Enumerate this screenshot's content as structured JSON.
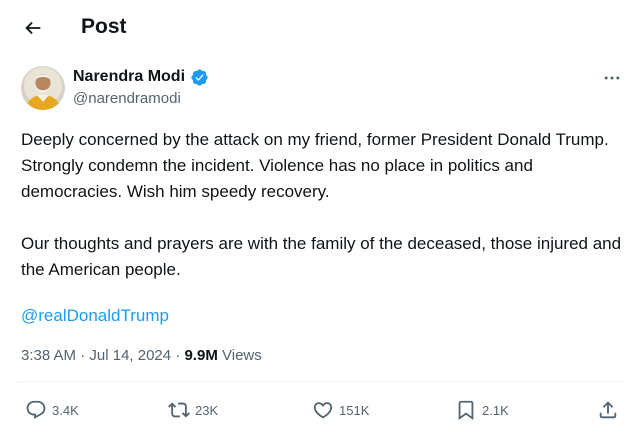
{
  "header": {
    "title": "Post"
  },
  "author": {
    "name": "Narendra Modi",
    "handle": "@narendramodi",
    "verified": true
  },
  "post": {
    "paragraph1": "Deeply concerned by the attack on my friend, former President Donald Trump. Strongly condemn the incident. Violence has no place in politics and democracies. Wish him speedy recovery.",
    "paragraph2": "Our thoughts and prayers are with the family of the deceased, those injured and the American people.",
    "mention": "@realDonaldTrump"
  },
  "meta": {
    "time": "3:38 AM",
    "separator": "·",
    "date": "Jul 14, 2024",
    "views_count": "9.9M",
    "views_label": "Views"
  },
  "actions": {
    "replies": "3.4K",
    "reposts": "23K",
    "likes": "151K",
    "bookmarks": "2.1K"
  },
  "colors": {
    "text": "#0f1419",
    "secondary": "#536471",
    "accent": "#1d9bf0",
    "verified": "#1d9bf0"
  },
  "icons": {
    "back": "arrow-left-icon",
    "verified": "verified-badge-icon",
    "more": "more-horizontal-icon",
    "reply": "reply-icon",
    "repost": "repost-icon",
    "like": "heart-icon",
    "bookmark": "bookmark-icon",
    "share": "share-icon"
  }
}
